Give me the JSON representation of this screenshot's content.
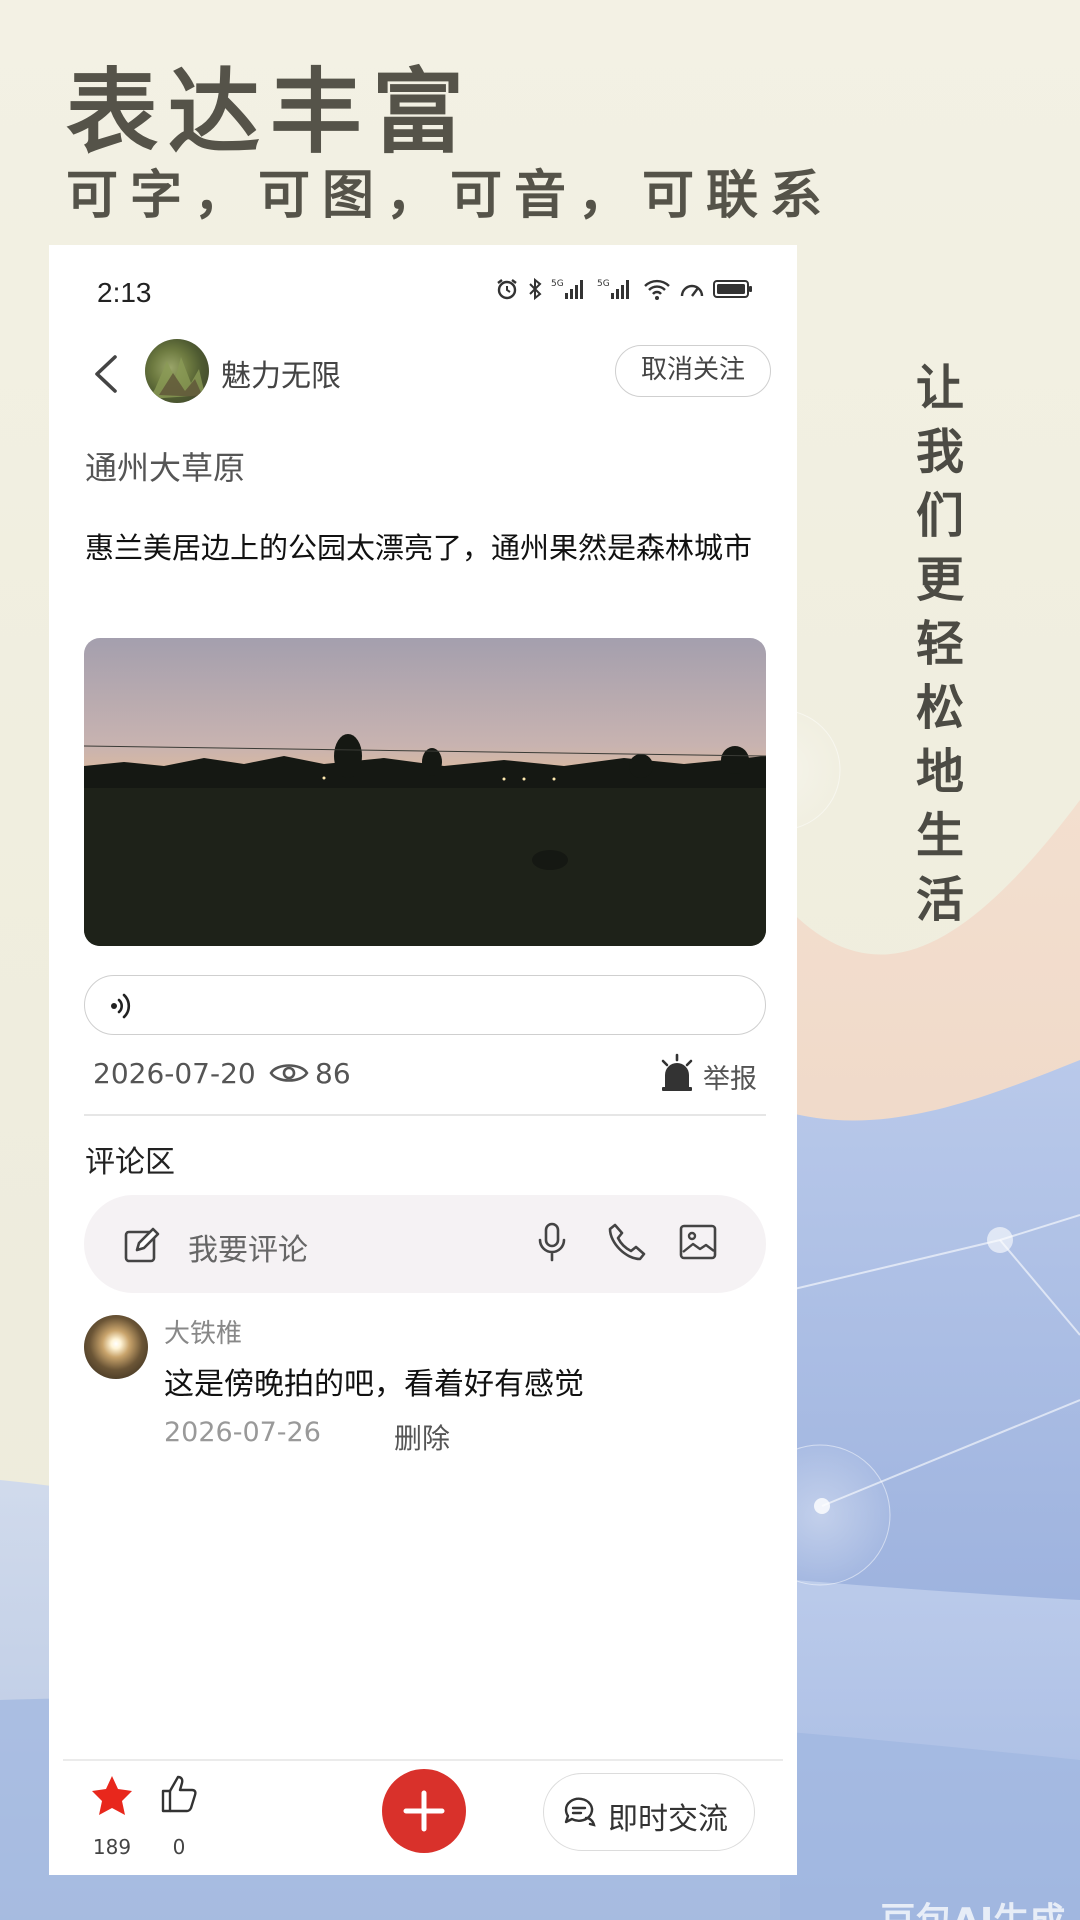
{
  "poster": {
    "title": "表达丰富",
    "subtitle": "可字，可图，可音，可联系",
    "vertical_slogan": "让我们更轻松地生活",
    "watermark": "豆包AI生成"
  },
  "status_bar": {
    "time": "2:13",
    "icons": [
      "alarm-icon",
      "bluetooth-icon",
      "signal-5g-icon",
      "signal-5g-icon",
      "wifi-icon",
      "speed-icon",
      "battery-icon"
    ]
  },
  "header": {
    "author_name": "魅力无限",
    "unfollow_label": "取消关注"
  },
  "post": {
    "title": "通州大草原",
    "body": "惠兰美居边上的公园太漂亮了，通州果然是森林城市",
    "date": "2026-07-20",
    "views": "86",
    "report_label": "举报"
  },
  "comments_section": {
    "heading": "评论区",
    "input_placeholder": "我要评论",
    "items": [
      {
        "user": "大铁椎",
        "text": "这是傍晚拍的吧，看着好有感觉",
        "date": "2026-07-26",
        "delete_label": "删除"
      }
    ]
  },
  "bottom_bar": {
    "favorites_count": "189",
    "likes_count": "0",
    "chat_label": "即时交流"
  },
  "colors": {
    "accent_red": "#d9312b",
    "favorite_star": "#e8271c"
  }
}
